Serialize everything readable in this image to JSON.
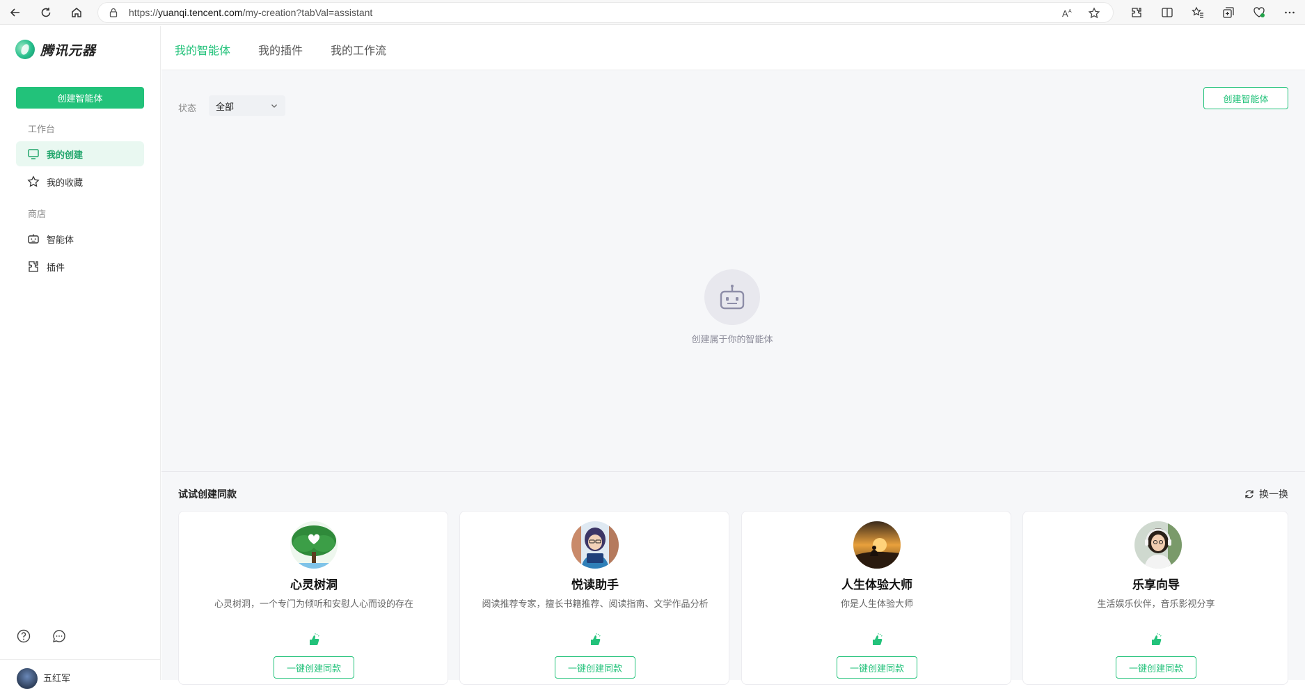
{
  "browser": {
    "url_prefix": "https://",
    "url_host": "yuanqi.tencent.com",
    "url_path": "/my-creation?tabVal=assistant"
  },
  "sidebar": {
    "logo_text": "腾讯元器",
    "create_button": "创建智能体",
    "section_workbench": "工作台",
    "items_workbench": [
      {
        "label": "我的创建"
      },
      {
        "label": "我的收藏"
      }
    ],
    "section_store": "商店",
    "items_store": [
      {
        "label": "智能体"
      },
      {
        "label": "插件"
      }
    ],
    "user_name": "五红军"
  },
  "main": {
    "tabs": [
      {
        "label": "我的智能体"
      },
      {
        "label": "我的插件"
      },
      {
        "label": "我的工作流"
      }
    ],
    "filter_label": "状态",
    "filter_value": "全部",
    "create_button": "创建智能体",
    "empty_text": "创建属于你的智能体",
    "try_title": "试试创建同款",
    "refresh_label": "换一换",
    "cards": [
      {
        "title": "心灵树洞",
        "desc": "心灵树洞，一个专门为倾听和安慰人心而设的存在",
        "button": "一键创建同款"
      },
      {
        "title": "悦读助手",
        "desc": "阅读推荐专家，擅长书籍推荐、阅读指南、文学作品分析",
        "button": "一键创建同款"
      },
      {
        "title": "人生体验大师",
        "desc": "你是人生体验大师",
        "button": "一键创建同款"
      },
      {
        "title": "乐享向导",
        "desc": "生活娱乐伙伴，音乐影视分享",
        "button": "一键创建同款"
      }
    ]
  },
  "colors": {
    "accent": "#22c27a",
    "active_bg": "#e9f8f1"
  }
}
